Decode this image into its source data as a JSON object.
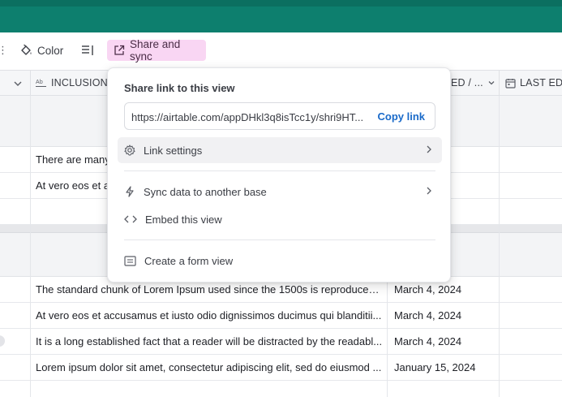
{
  "toolbar": {
    "edge_glyph": "⋮",
    "color_label": "Color",
    "share_label": "Share and sync"
  },
  "header": {
    "inclusion_label": "INCLUSION",
    "hidden_col_label": "ED / ...",
    "last_edited_label": "LAST ED..."
  },
  "group1": {
    "rows": [
      {
        "inclusion": "There are many",
        "date": ""
      },
      {
        "inclusion": "At vero eos et a",
        "date": ""
      }
    ]
  },
  "group2": {
    "rows": [
      {
        "inclusion": "The standard chunk of Lorem Ipsum used since the 1500s is reproduced ...",
        "date": "March 4, 2024"
      },
      {
        "inclusion": "At vero eos et accusamus et iusto odio dignissimos ducimus qui blanditii...",
        "date": "March 4, 2024"
      },
      {
        "inclusion": "It is a long established fact that a reader will be distracted by the readabl...",
        "date": "March 4, 2024"
      },
      {
        "inclusion": "Lorem ipsum dolor sit amet, consectetur adipiscing elit, sed do eiusmod ...",
        "date": "January 15, 2024"
      }
    ]
  },
  "popover": {
    "title": "Share link to this view",
    "url": "https://airtable.com/appDHkl3q8isTcc1y/shri9HT...",
    "copy_label": "Copy link",
    "link_settings": "Link settings",
    "sync_data": "Sync data to another base",
    "embed": "Embed this view",
    "create_form": "Create a form view"
  },
  "colors": {
    "topbar": "#0d7f6e",
    "share_button_bg": "#f9d6f3",
    "copy_link": "#1a6ac9"
  },
  "icons": {
    "color": "paint-bucket-icon",
    "row_height": "row-height-icon",
    "share": "external-link-icon",
    "text_field": "text-field-icon",
    "calendar": "calendar-icon",
    "gear": "gear-icon",
    "bolt": "bolt-icon",
    "embed": "code-brackets-icon",
    "form": "form-icon",
    "chevron": "chevron-right-icon"
  }
}
